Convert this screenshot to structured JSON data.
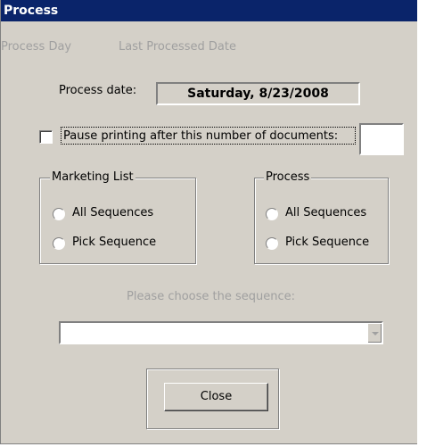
{
  "window": {
    "title": "Process"
  },
  "menu": {
    "items": [
      "Process Day",
      "Last Processed Date"
    ]
  },
  "process_date": {
    "label": "Process date:",
    "value": "Saturday, 8/23/2008"
  },
  "pause": {
    "label": "Pause printing after this number of documents:",
    "checked": false,
    "value": ""
  },
  "marketing_group": {
    "title": "Marketing List",
    "options": [
      "All Sequences",
      "Pick Sequence"
    ]
  },
  "process_group": {
    "title": "Process",
    "options": [
      "All Sequences",
      "Pick Sequence"
    ]
  },
  "sequence": {
    "label": "Please choose the sequence:",
    "value": ""
  },
  "buttons": {
    "close": "Close"
  }
}
